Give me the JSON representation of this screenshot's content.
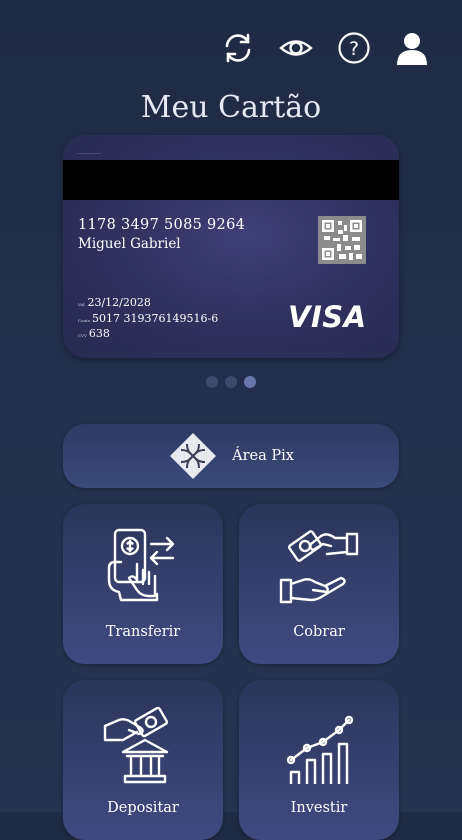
{
  "header": {
    "icons": [
      "refresh-icon",
      "eye-icon",
      "help-icon",
      "user-icon"
    ],
    "help_symbol": "?"
  },
  "page_title": "Meu Cartão",
  "card": {
    "top_text": "____________",
    "number": "1178 3497 5085 9264",
    "holder": "Miguel Gabriel",
    "validity_label": "Val.",
    "validity": "23/12/2028",
    "account_label": "Conta",
    "account": "5017 319376149516-6",
    "cvv_label": "CVV",
    "cvv": "638",
    "brand": "VISA",
    "qr_icon": "qr-code-icon"
  },
  "carousel": {
    "count": 3,
    "active_index": 2
  },
  "pix": {
    "label": "Área Pix",
    "icon": "pix-icon"
  },
  "actions": [
    {
      "label": "Transferir",
      "icon": "transfer-icon"
    },
    {
      "label": "Cobrar",
      "icon": "charge-icon"
    },
    {
      "label": "Depositar",
      "icon": "deposit-icon"
    },
    {
      "label": "Investir",
      "icon": "invest-icon"
    }
  ],
  "colors": {
    "background": "#232f4c",
    "card": "#31325f",
    "tile": "#3f4a82",
    "dot_active": "#6878ad"
  }
}
